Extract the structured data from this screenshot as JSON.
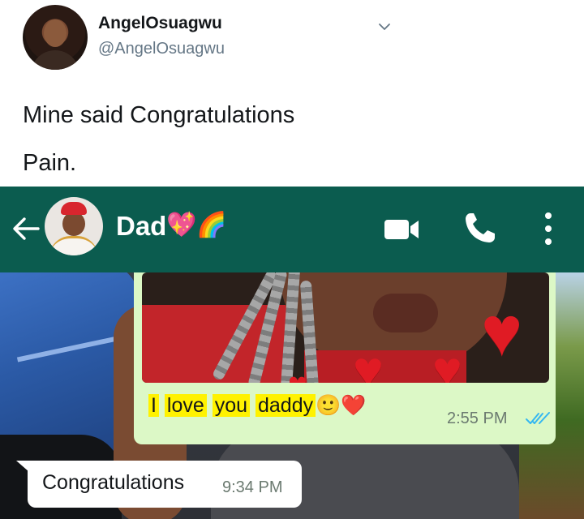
{
  "tweet": {
    "display_name": "AngelOsuagwu",
    "handle": "@AngelOsuagwu",
    "text_lines": [
      "Mine said Congratulations",
      "Pain."
    ],
    "menu_icon": "chevron-down-icon"
  },
  "whatsapp": {
    "header": {
      "back_icon": "arrow-left-icon",
      "contact_name": "Dad",
      "contact_emojis": "💖🌈",
      "actions": [
        "video-call-icon",
        "phone-icon",
        "more-vertical-icon"
      ],
      "bar_color": "#0b5c4f"
    },
    "messages": [
      {
        "direction": "outgoing",
        "has_photo": true,
        "text_parts": [
          "I",
          "love",
          "you",
          "daddy"
        ],
        "emojis": "🙂❤️",
        "time": "2:55 PM",
        "status": "read",
        "bubble_color": "#dcf8c6",
        "highlight_color": "#fff200"
      },
      {
        "direction": "incoming",
        "text": "Congratulations",
        "time": "9:34 PM",
        "bubble_color": "#ffffff"
      }
    ]
  }
}
